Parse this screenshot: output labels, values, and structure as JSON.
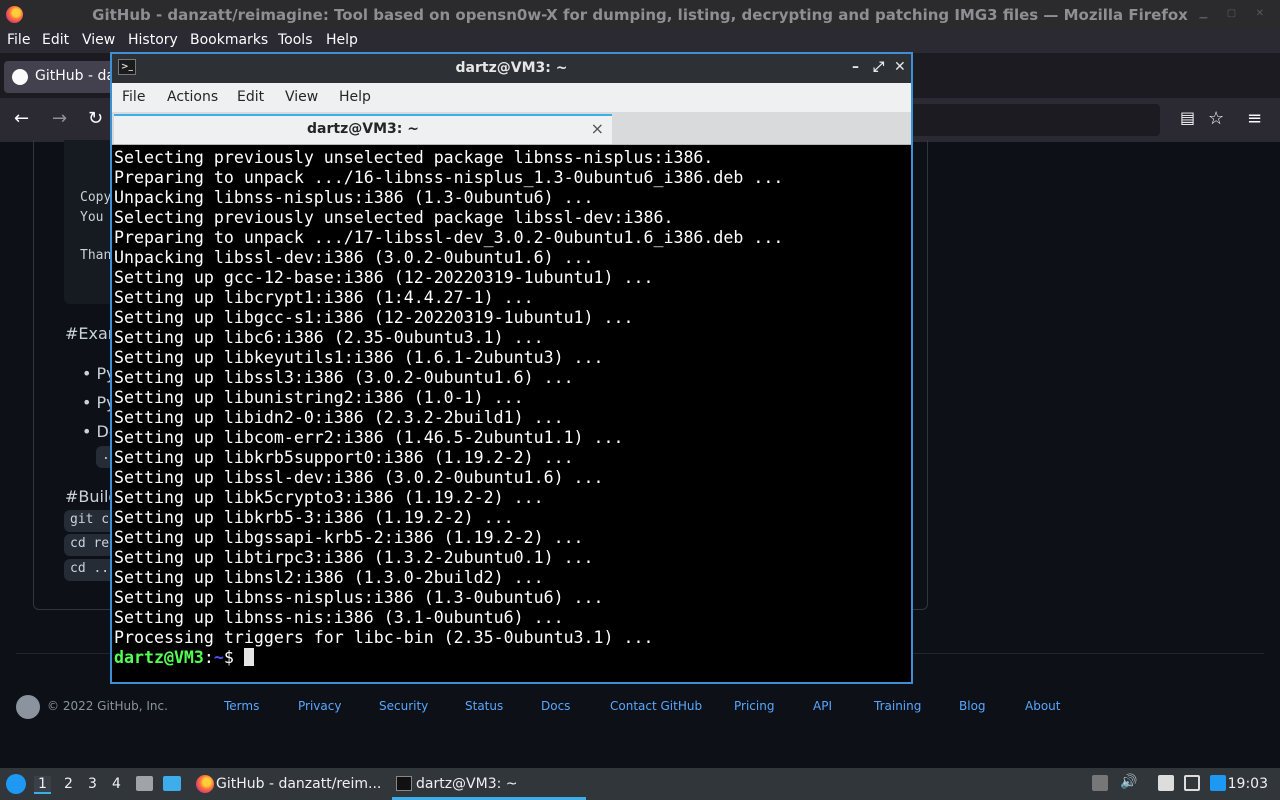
{
  "firefox": {
    "window_title": "GitHub - danzatt/reimagine: Tool based on opensn0w-X for dumping, listing, decrypting and patching IMG3 files — Mozilla Firefox",
    "menu": [
      "File",
      "Edit",
      "View",
      "History",
      "Bookmarks",
      "Tools",
      "Help"
    ],
    "tab_label": "GitHub - dan",
    "nav": {
      "back": "←",
      "forward": "→",
      "reload": "↻",
      "reader": "▤",
      "bookmark": "☆",
      "menu": "≡"
    }
  },
  "github": {
    "code_lines": [
      "Copy",
      "You",
      "Than"
    ],
    "heading_examples": "#Exam",
    "bullets": [
      "• Py",
      "• Py",
      "• De"
    ],
    "chip_ellipsis": "..",
    "heading_build": "#Build",
    "build_chips": [
      "git c",
      "cd re",
      "cd .."
    ],
    "footer": {
      "copyright": "© 2022 GitHub, Inc.",
      "links": [
        "Terms",
        "Privacy",
        "Security",
        "Status",
        "Docs",
        "Contact GitHub",
        "Pricing",
        "API",
        "Training",
        "Blog",
        "About"
      ]
    }
  },
  "terminal": {
    "title": "dartz@VM3: ~",
    "menu": [
      "File",
      "Actions",
      "Edit",
      "View",
      "Help"
    ],
    "tab_label": "dartz@VM3: ~",
    "tab_close": "×",
    "controls": {
      "minimize": "–",
      "maximize": "⤢",
      "close": "✕"
    },
    "lines": [
      "Selecting previously unselected package libnss-nisplus:i386.",
      "Preparing to unpack .../16-libnss-nisplus_1.3-0ubuntu6_i386.deb ...",
      "Unpacking libnss-nisplus:i386 (1.3-0ubuntu6) ...",
      "Selecting previously unselected package libssl-dev:i386.",
      "Preparing to unpack .../17-libssl-dev_3.0.2-0ubuntu1.6_i386.deb ...",
      "Unpacking libssl-dev:i386 (3.0.2-0ubuntu1.6) ...",
      "Setting up gcc-12-base:i386 (12-20220319-1ubuntu1) ...",
      "Setting up libcrypt1:i386 (1:4.4.27-1) ...",
      "Setting up libgcc-s1:i386 (12-20220319-1ubuntu1) ...",
      "Setting up libc6:i386 (2.35-0ubuntu3.1) ...",
      "Setting up libkeyutils1:i386 (1.6.1-2ubuntu3) ...",
      "Setting up libssl3:i386 (3.0.2-0ubuntu1.6) ...",
      "Setting up libunistring2:i386 (1.0-1) ...",
      "Setting up libidn2-0:i386 (2.3.2-2build1) ...",
      "Setting up libcom-err2:i386 (1.46.5-2ubuntu1.1) ...",
      "Setting up libkrb5support0:i386 (1.19.2-2) ...",
      "Setting up libssl-dev:i386 (3.0.2-0ubuntu1.6) ...",
      "Setting up libk5crypto3:i386 (1.19.2-2) ...",
      "Setting up libkrb5-3:i386 (1.19.2-2) ...",
      "Setting up libgssapi-krb5-2:i386 (1.19.2-2) ...",
      "Setting up libtirpc3:i386 (1.3.2-2ubuntu0.1) ...",
      "Setting up libnsl2:i386 (1.3.0-2build2) ...",
      "Setting up libnss-nisplus:i386 (1.3-0ubuntu6) ...",
      "Setting up libnss-nis:i386 (3.1-0ubuntu6) ...",
      "Processing triggers for libc-bin (2.35-0ubuntu3.1) ..."
    ],
    "prompt_user": "dartz@VM3",
    "prompt_sep": ":",
    "prompt_path": "~",
    "prompt_symbol": "$ "
  },
  "taskbar": {
    "workspaces": [
      "1",
      "2",
      "3",
      "4"
    ],
    "tasks": [
      {
        "label": "GitHub - danzatt/reim..."
      },
      {
        "label": "dartz@VM3: ~"
      }
    ],
    "clock": "19:03"
  },
  "colors": {
    "terminal_bg": "#000000",
    "prompt_user": "#54ff54",
    "prompt_path": "#5454ff",
    "accent": "#3daee9",
    "github_link": "#58a6ff"
  }
}
